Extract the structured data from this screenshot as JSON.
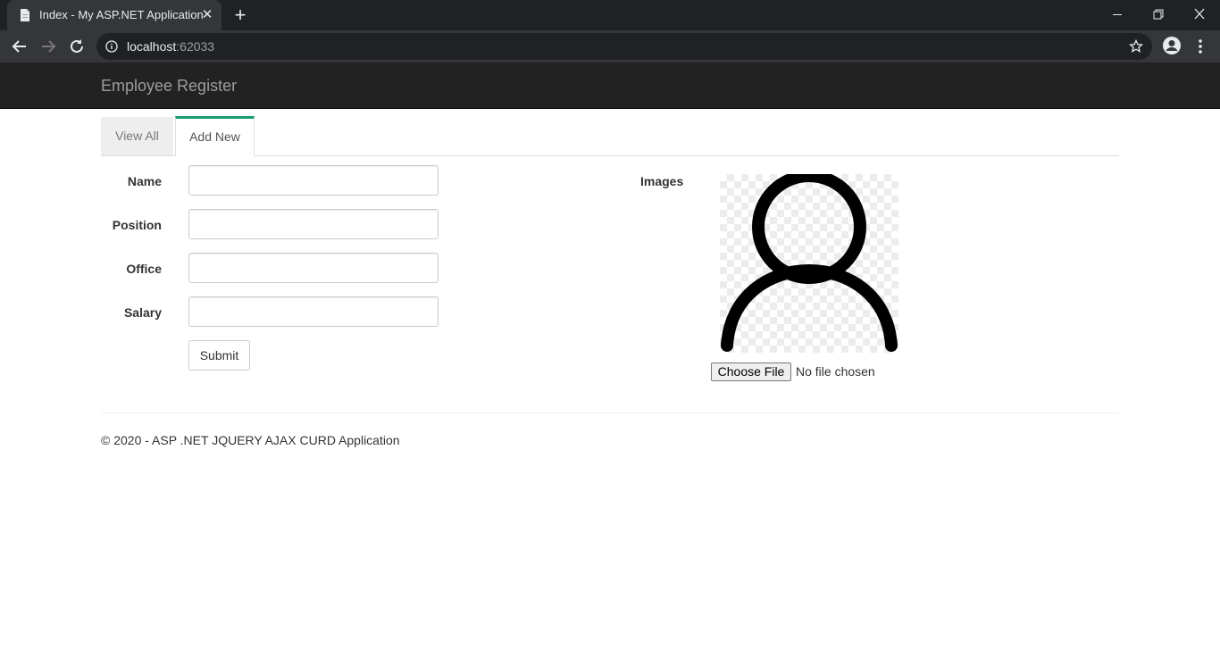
{
  "browser": {
    "tab_title": "Index - My ASP.NET Application",
    "url_host": "localhost",
    "url_port": ":62033"
  },
  "navbar": {
    "brand": "Employee Register"
  },
  "tabs": [
    {
      "label": "View All",
      "active": false
    },
    {
      "label": "Add New",
      "active": true
    }
  ],
  "form": {
    "fields": [
      {
        "label": "Name",
        "value": ""
      },
      {
        "label": "Position",
        "value": ""
      },
      {
        "label": "Office",
        "value": ""
      },
      {
        "label": "Salary",
        "value": ""
      }
    ],
    "submit_label": "Submit",
    "images_label": "Images",
    "choose_file_label": "Choose File",
    "file_status": "No file chosen"
  },
  "footer": {
    "text": "© 2020 - ASP .NET JQUERY AJAX CURD Application"
  },
  "colors": {
    "accent": "#1a9c6d",
    "navbar": "#222222"
  }
}
